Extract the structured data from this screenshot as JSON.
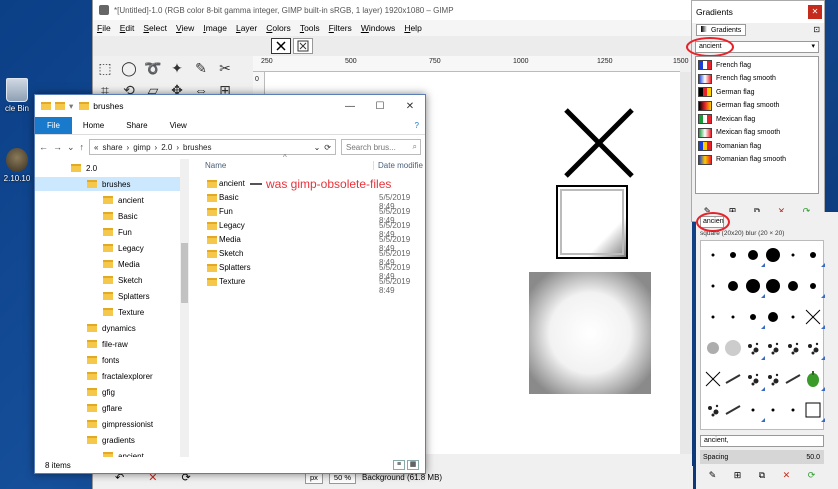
{
  "desktop": {
    "recycle_label": "cle Bin",
    "gimp_label": "2.10.10"
  },
  "gimp": {
    "title": "*[Untitled]-1.0 (RGB color 8-bit gamma integer, GIMP built-in sRGB, 1 layer) 1920x1080 – GIMP",
    "menu": [
      "File",
      "Edit",
      "Select",
      "View",
      "Image",
      "Layer",
      "Colors",
      "Tools",
      "Filters",
      "Windows",
      "Help"
    ],
    "ruler_top_ticks": [
      "250",
      "500",
      "750",
      "1000",
      "1250",
      "1500"
    ],
    "ruler_left_ticks": [
      "0",
      "250",
      "500"
    ],
    "status": {
      "unit": "px",
      "zoom": "50 %",
      "layer_info": "Background (61.8 MB)"
    }
  },
  "explorer": {
    "title": "brushes",
    "ribbon_tabs": [
      "File",
      "Home",
      "Share",
      "View"
    ],
    "address": [
      "share",
      "gimp",
      "2.0",
      "brushes"
    ],
    "address_prefix": "«",
    "search_placeholder": "Search brus...",
    "nav_items": [
      {
        "label": "2.0",
        "indent": 1,
        "selected": false
      },
      {
        "label": "brushes",
        "indent": 2,
        "selected": true
      },
      {
        "label": "ancient",
        "indent": 3,
        "selected": false
      },
      {
        "label": "Basic",
        "indent": 3,
        "selected": false
      },
      {
        "label": "Fun",
        "indent": 3,
        "selected": false
      },
      {
        "label": "Legacy",
        "indent": 3,
        "selected": false
      },
      {
        "label": "Media",
        "indent": 3,
        "selected": false
      },
      {
        "label": "Sketch",
        "indent": 3,
        "selected": false
      },
      {
        "label": "Splatters",
        "indent": 3,
        "selected": false
      },
      {
        "label": "Texture",
        "indent": 3,
        "selected": false
      },
      {
        "label": "dynamics",
        "indent": 2,
        "selected": false
      },
      {
        "label": "file-raw",
        "indent": 2,
        "selected": false
      },
      {
        "label": "fonts",
        "indent": 2,
        "selected": false
      },
      {
        "label": "fractalexplorer",
        "indent": 2,
        "selected": false
      },
      {
        "label": "gfig",
        "indent": 2,
        "selected": false
      },
      {
        "label": "gflare",
        "indent": 2,
        "selected": false
      },
      {
        "label": "gimpressionist",
        "indent": 2,
        "selected": false
      },
      {
        "label": "gradients",
        "indent": 2,
        "selected": false
      },
      {
        "label": "ancient",
        "indent": 3,
        "selected": false
      }
    ],
    "columns": {
      "name": "Name",
      "date": "Date modifie"
    },
    "files": [
      {
        "name": "ancient",
        "date": ""
      },
      {
        "name": "Basic",
        "date": "5/5/2019 8:49"
      },
      {
        "name": "Fun",
        "date": "5/5/2019 8:49"
      },
      {
        "name": "Legacy",
        "date": "5/5/2019 8:49"
      },
      {
        "name": "Media",
        "date": "5/5/2019 8:49"
      },
      {
        "name": "Sketch",
        "date": "5/5/2019 8:49"
      },
      {
        "name": "Splatters",
        "date": "5/5/2019 8:49"
      },
      {
        "name": "Texture",
        "date": "5/5/2019 8:49"
      }
    ],
    "status_count": "8 items",
    "annotation": "was gimp-obsolete-files"
  },
  "gradients": {
    "title": "Gradients",
    "tab_label": "Gradients",
    "filter_value": "ancient",
    "items": [
      {
        "name": "French flag",
        "colors": [
          "#1a3fd6",
          "#ffffff",
          "#e8222a"
        ],
        "smooth": false
      },
      {
        "name": "French flag smooth",
        "colors": [
          "#1a3fd6",
          "#ffffff",
          "#e8222a"
        ],
        "smooth": true
      },
      {
        "name": "German flag",
        "colors": [
          "#000000",
          "#e8222a",
          "#ffcc00"
        ],
        "smooth": false
      },
      {
        "name": "German flag smooth",
        "colors": [
          "#000000",
          "#e8222a",
          "#ffcc00"
        ],
        "smooth": true
      },
      {
        "name": "Mexican flag",
        "colors": [
          "#1a9a3a",
          "#ffffff",
          "#e8222a"
        ],
        "smooth": false
      },
      {
        "name": "Mexican flag smooth",
        "colors": [
          "#1a9a3a",
          "#ffffff",
          "#e8222a"
        ],
        "smooth": true
      },
      {
        "name": "Romanian flag",
        "colors": [
          "#1a3fd6",
          "#ffcc00",
          "#e8222a"
        ],
        "smooth": false
      },
      {
        "name": "Romanian flag smooth",
        "colors": [
          "#1a3fd6",
          "#ffcc00",
          "#e8222a"
        ],
        "smooth": true
      }
    ]
  },
  "brushes": {
    "filter_value": "ancien",
    "selected_brush": "square (20x20) blur (20 × 20)",
    "tag_value": "ancient,",
    "spacing_label": "Spacing",
    "spacing_value": "50.0"
  }
}
